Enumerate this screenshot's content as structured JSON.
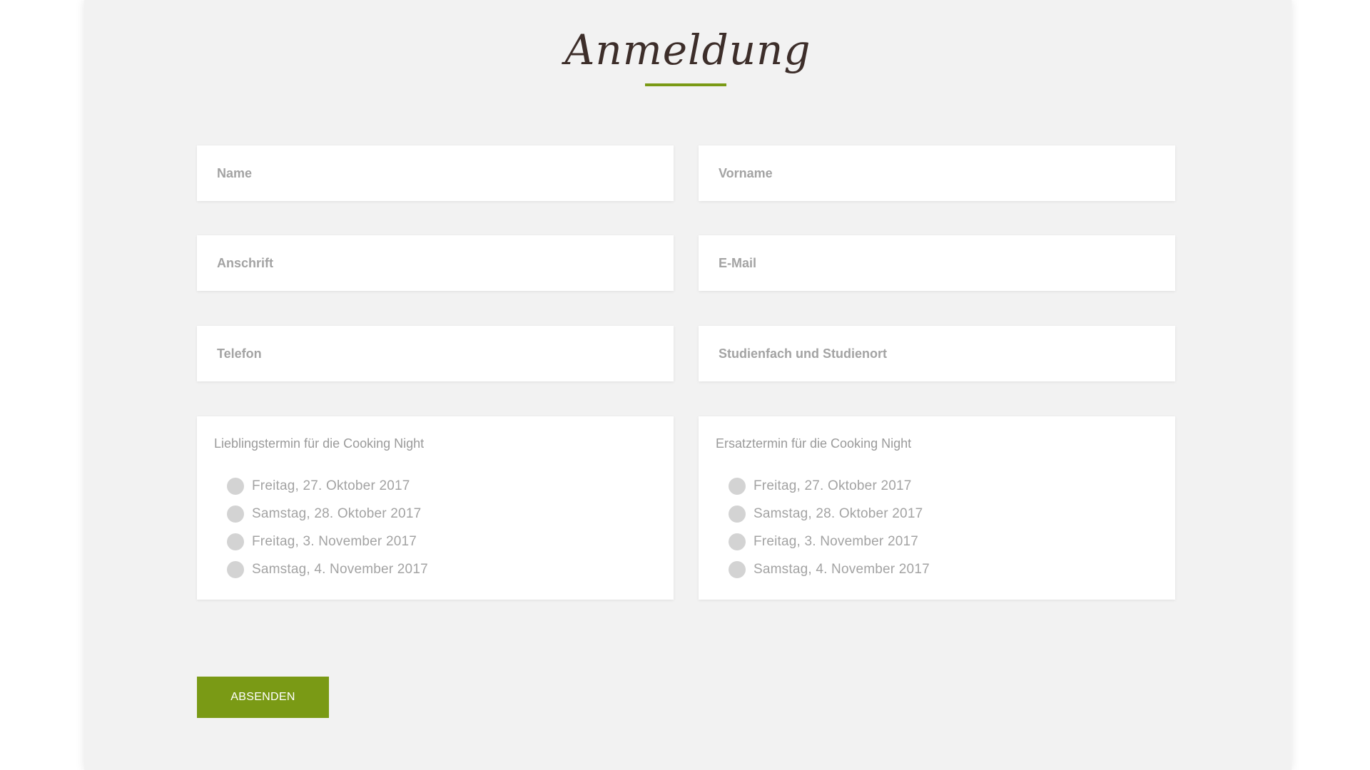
{
  "form": {
    "title": "Anmeldung",
    "fields": {
      "name": "Name",
      "vorname": "Vorname",
      "anschrift": "Anschrift",
      "email": "E-Mail",
      "telefon": "Telefon",
      "studium": "Studienfach und Studienort"
    },
    "preferred": {
      "legend": "Lieblingstermin für die Cooking Night",
      "options": [
        "Freitag, 27. Oktober 2017",
        "Samstag, 28. Oktober 2017",
        "Freitag, 3. November 2017",
        "Samstag, 4. November 2017"
      ]
    },
    "alternate": {
      "legend": "Ersatztermin für die Cooking Night",
      "options": [
        "Freitag, 27. Oktober 2017",
        "Samstag, 28. Oktober 2017",
        "Freitag, 3. November 2017",
        "Samstag, 4. November 2017"
      ]
    },
    "submit_label": "ABSENDEN"
  },
  "colors": {
    "accent": "#7a9a15",
    "title": "#3d2e2a",
    "background": "#f2f2f2",
    "placeholder": "#a3a3a3"
  }
}
